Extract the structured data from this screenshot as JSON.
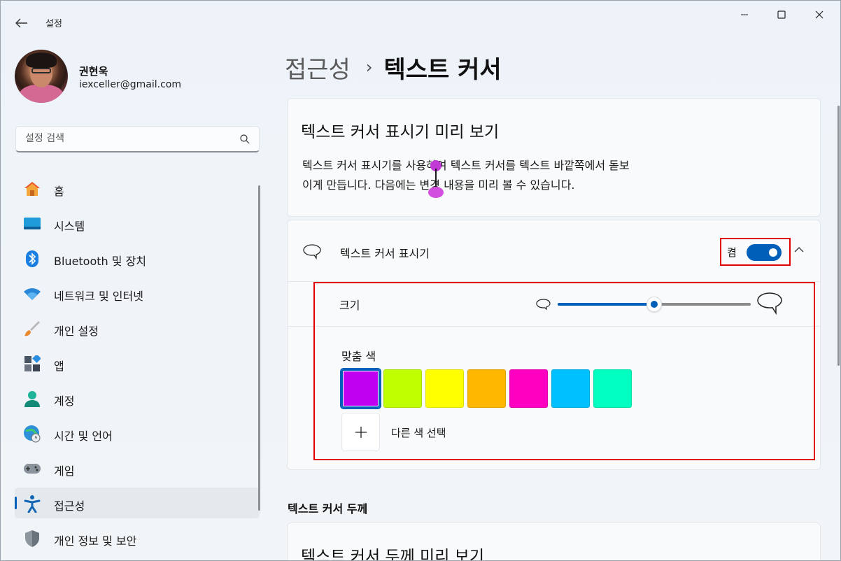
{
  "window": {
    "app_title": "설정",
    "back_icon": "arrow-left-icon",
    "controls": [
      "minimize-icon",
      "maximize-icon",
      "close-icon"
    ]
  },
  "profile": {
    "name": "권현욱",
    "email": "iexceller@gmail.com"
  },
  "search": {
    "placeholder": "설정 검색",
    "icon": "search-icon"
  },
  "sidebar": {
    "items": [
      {
        "label": "홈",
        "icon": "home-icon"
      },
      {
        "label": "시스템",
        "icon": "system-icon"
      },
      {
        "label": "Bluetooth 및 장치",
        "icon": "bluetooth-icon"
      },
      {
        "label": "네트워크 및 인터넷",
        "icon": "wifi-icon"
      },
      {
        "label": "개인 설정",
        "icon": "brush-icon"
      },
      {
        "label": "앱",
        "icon": "apps-icon"
      },
      {
        "label": "계정",
        "icon": "account-icon"
      },
      {
        "label": "시간 및 언어",
        "icon": "globe-clock-icon"
      },
      {
        "label": "게임",
        "icon": "gamepad-icon"
      },
      {
        "label": "접근성",
        "icon": "accessibility-icon",
        "active": true
      },
      {
        "label": "개인 정보 및 보안",
        "icon": "shield-icon"
      }
    ]
  },
  "breadcrumb": {
    "parent": "접근성",
    "separator": "›",
    "current": "텍스트 커서"
  },
  "preview": {
    "title": "텍스트 커서 표시기 미리 보기",
    "line1": "텍스트 커서 표시기를 사용하여 텍스트 커서를 텍스트 바깥쪽에서 돋보",
    "line2": "이게 만듭니다. 다음에는 변경 내용을 미리 볼 수 있습니다."
  },
  "indicator": {
    "label": "텍스트 커서 표시기",
    "toggle_state": "켬",
    "toggle_on": true,
    "size_label": "크기",
    "size_level": 0.5,
    "custom_color_label": "맞춤 색",
    "colors": [
      "#c000f0",
      "#c0ff00",
      "#ffff00",
      "#ffb700",
      "#ff00c0",
      "#00c0ff",
      "#00ffc0"
    ],
    "selected_color_index": 0,
    "add_color_label": "다른 색 선택"
  },
  "thickness": {
    "section_header": "텍스트 커서 두께",
    "preview_title": "텍스트 커서 두께 미리 보기"
  },
  "colors": {
    "accent": "#005fb8",
    "highlight": "#e00000",
    "cursor_marker": "#c23ad6"
  }
}
